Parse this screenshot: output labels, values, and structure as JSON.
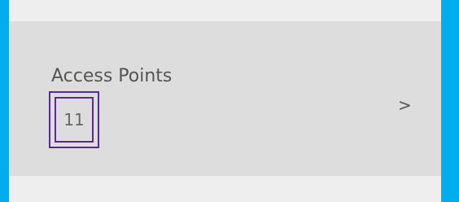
{
  "card": {
    "title": "Access Points",
    "count": "11",
    "chevron": ">"
  },
  "colors": {
    "accent": "#00aeef",
    "card_background": "#dddddd",
    "page_background": "#eeeeee",
    "highlight_border": "#5b2a9a"
  },
  "icons": {
    "chevron": "chevron-right-icon"
  }
}
